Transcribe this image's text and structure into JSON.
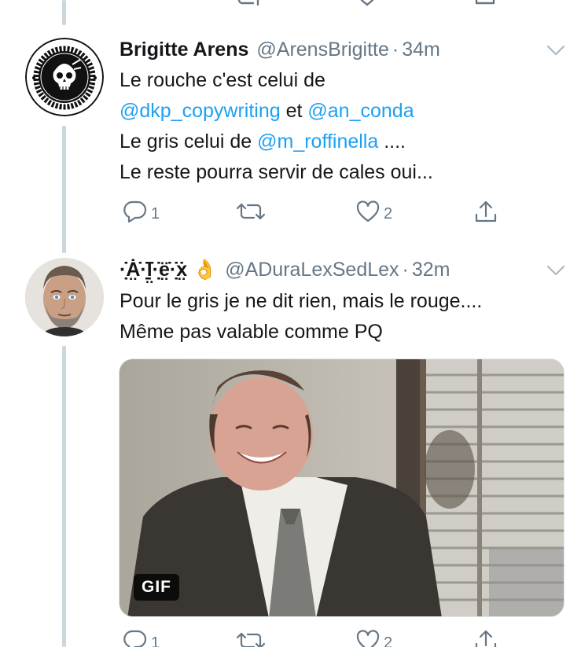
{
  "thread": {
    "tweets": [
      {
        "display_name": "Brigitte Arens",
        "handle": "@ArensBrigitte",
        "separator": "·",
        "time": "34m",
        "avatar": {
          "kind": "punk-badge",
          "badge_text_top": "PUNKS NOT DEAD",
          "badge_text_bottom": "PUNKS NOT DEAD"
        },
        "lines": [
          [
            {
              "t": "Le rouche c'est celui de",
              "type": "text"
            }
          ],
          [
            {
              "t": "@dkp_copywriting",
              "type": "mention"
            },
            {
              "t": " et ",
              "type": "text"
            },
            {
              "t": "@an_conda",
              "type": "mention"
            }
          ],
          [
            {
              "t": "Le gris celui de ",
              "type": "text"
            },
            {
              "t": "@m_roffinella",
              "type": "mention"
            },
            {
              "t": " ....",
              "type": "text"
            }
          ],
          [
            {
              "t": "Le reste pourra servir de cales oui...",
              "type": "text"
            }
          ]
        ],
        "replies": "1",
        "retweets": "",
        "likes": "2"
      },
      {
        "display_name": "·̣̇̇Ȧ̤̇·̣̣̇ḷ̤̇·̣̣̇ë̤̇·̣̣̇ẋ̤ 👌",
        "handle": "@ADuraLexSedLex",
        "separator": "·",
        "time": "32m",
        "avatar": {
          "kind": "photo-man"
        },
        "lines": [
          [
            {
              "t": "Pour le gris je ne dit rien, mais le rouge....",
              "type": "text"
            }
          ],
          [
            {
              "t": "Même pas valable comme PQ",
              "type": "text"
            }
          ]
        ],
        "media": {
          "kind": "gif",
          "badge": "GIF"
        },
        "replies": "1",
        "retweets": "",
        "likes": "2"
      }
    ]
  },
  "icons": {
    "reply": "reply-icon",
    "retweet": "retweet-icon",
    "like": "heart-icon",
    "share": "share-icon",
    "caret": "chevron-down-icon"
  },
  "colors": {
    "link": "#1da1f2",
    "secondary_text": "#657786",
    "thread_line": "#ccd6dd",
    "text": "#14171a"
  }
}
